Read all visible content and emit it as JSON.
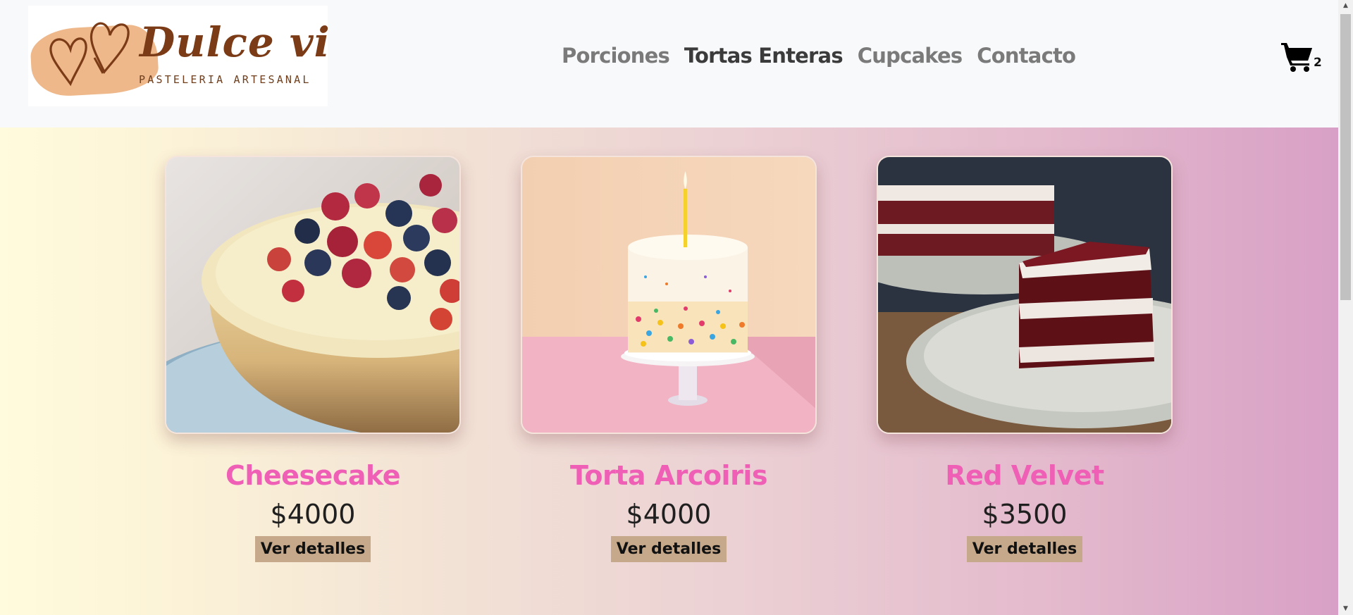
{
  "brand": {
    "name": "Dulce vida",
    "tagline": "PASTELERIA ARTESANAL",
    "colors": {
      "swatch": "#eeb88b",
      "text": "#7a3b16"
    }
  },
  "nav": {
    "items": [
      {
        "label": "Porciones",
        "active": false
      },
      {
        "label": "Tortas Enteras",
        "active": true
      },
      {
        "label": "Cupcakes",
        "active": false
      },
      {
        "label": "Contacto",
        "active": false
      }
    ]
  },
  "cart": {
    "icon": "shopping-cart-icon",
    "count": "2"
  },
  "products": [
    {
      "name": "Cheesecake",
      "price": "$4000",
      "button": "Ver detalles",
      "image": "cheesecake-with-berries"
    },
    {
      "name": "Torta Arcoiris",
      "price": "$4000",
      "button": "Ver detalles",
      "image": "rainbow-sprinkle-cake-with-candle"
    },
    {
      "name": "Red Velvet",
      "price": "$3500",
      "button": "Ver detalles",
      "image": "red-velvet-cake-slice"
    }
  ],
  "theme": {
    "title_color": "#ee5fb5",
    "button_color": "#c6a98a",
    "gradient_start": "#fffbdc",
    "gradient_end": "#d8a0c6"
  }
}
